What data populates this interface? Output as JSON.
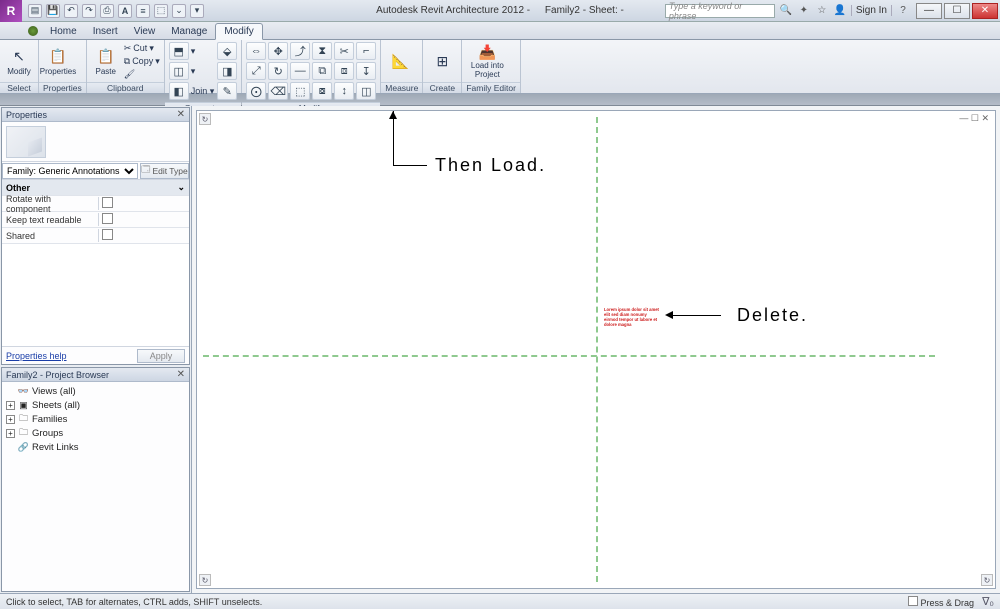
{
  "titlebar": {
    "app_letter": "R",
    "title": "Autodesk Revit Architecture 2012 -",
    "doc": "Family2 - Sheet: -",
    "search_placeholder": "Type a keyword or phrase",
    "signin": "Sign In"
  },
  "tabs": {
    "items": [
      "Home",
      "Insert",
      "View",
      "Manage",
      "Modify"
    ],
    "active": 4,
    "bullet": true
  },
  "ribbon": {
    "panels": [
      {
        "label": "Select",
        "big": [
          {
            "name": "modify",
            "text": "Modify",
            "glyph": "↖"
          }
        ]
      },
      {
        "label": "Properties",
        "big": [
          {
            "name": "properties",
            "text": "Properties",
            "glyph": "📋"
          }
        ]
      },
      {
        "label": "Clipboard",
        "big": [
          {
            "name": "paste",
            "text": "Paste",
            "glyph": "📄"
          }
        ],
        "rows": [
          {
            "name": "cut",
            "text": "Cut",
            "glyph": "✂"
          },
          {
            "name": "copy",
            "text": "Copy",
            "glyph": "⧉"
          },
          {
            "name": "match",
            "text": "",
            "glyph": "🖌"
          }
        ]
      },
      {
        "label": "Geometry",
        "rows": [
          {
            "name": "cope",
            "text": "",
            "glyph": "⬒"
          },
          {
            "name": "cutgeo",
            "text": "",
            "glyph": "◫"
          },
          {
            "name": "join",
            "text": "Join ▾",
            "glyph": "◧"
          }
        ]
      },
      {
        "label": "Modify",
        "grid": [
          "↔",
          "⇅",
          "⤴",
          "✂",
          "⤡",
          "⌐",
          "⤢",
          "↻",
          "——",
          "⧉",
          "⧈",
          "↧",
          "⨀",
          "⌫",
          "⬚",
          "⧇",
          "↕",
          "◫"
        ]
      },
      {
        "label": "Measure",
        "big": [
          {
            "name": "measure",
            "text": "",
            "glyph": "📐"
          }
        ]
      },
      {
        "label": "Create",
        "big": [
          {
            "name": "create",
            "text": "",
            "glyph": "⊞"
          }
        ]
      },
      {
        "label": "Family Editor",
        "big": [
          {
            "name": "load-project",
            "text": "Load into Project",
            "glyph": "⬆"
          }
        ]
      }
    ]
  },
  "properties": {
    "header": "Properties",
    "type_selector": "Family: Generic Annotations",
    "edit_type": "Edit Type",
    "group": "Other",
    "rows": [
      {
        "k": "Rotate with component",
        "v": ""
      },
      {
        "k": "Keep text readable",
        "v": ""
      },
      {
        "k": "Shared",
        "v": ""
      }
    ],
    "help": "Properties help",
    "apply": "Apply"
  },
  "browser": {
    "header": "Family2 - Project Browser",
    "nodes": [
      {
        "tw": "",
        "icon": "◌",
        "label": "Views (all)"
      },
      {
        "tw": "+",
        "icon": "▣",
        "label": "Sheets (all)"
      },
      {
        "tw": "+",
        "icon": "🗀",
        "label": "Families"
      },
      {
        "tw": "+",
        "icon": "🗀",
        "label": "Groups"
      },
      {
        "tw": "",
        "icon": "🔗",
        "label": "Revit Links"
      }
    ]
  },
  "canvas": {
    "red_text": "Lorem ipsum dolor sit amet elit sed diam nonumy eirmod tempor ut labore et dolore magna",
    "annot_load": "Then Load.",
    "annot_delete": "Delete.",
    "doc_controls": "— ☐ ✕"
  },
  "statusbar": {
    "left": "Click to select, TAB for alternates, CTRL adds, SHIFT unselects.",
    "press_drag": "Press & Drag"
  }
}
